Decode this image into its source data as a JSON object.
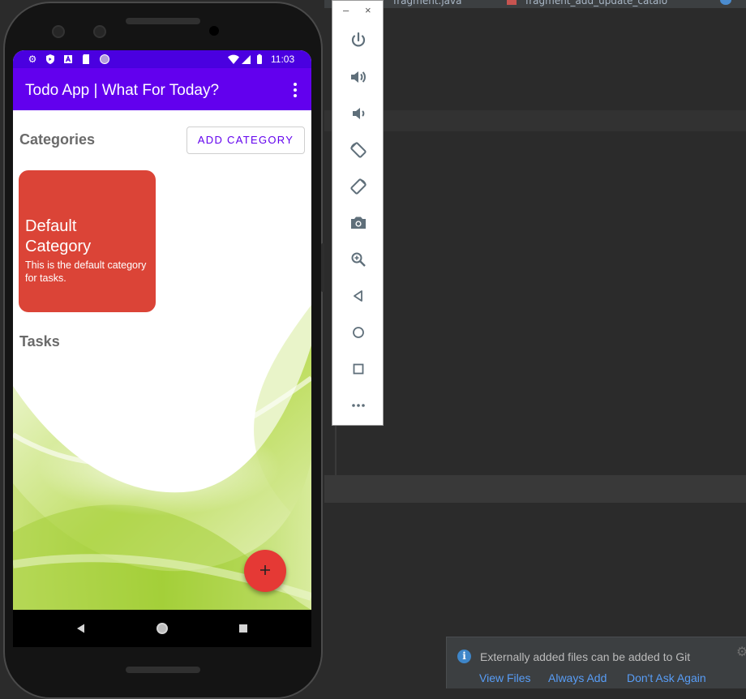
{
  "ide": {
    "tabs": [
      {
        "label": "fragment.java"
      },
      {
        "label": "fragment_add_update_catalo"
      }
    ]
  },
  "notification": {
    "message": "Externally added files can be added to Git",
    "actions": [
      "View Files",
      "Always Add",
      "Don't Ask Again"
    ]
  },
  "emulator_toolbar": {
    "minimize_label": "–",
    "close_label": "×",
    "buttons": [
      "power-icon",
      "volume-up-icon",
      "volume-down-icon",
      "rotate-left-icon",
      "rotate-right-icon",
      "camera-icon",
      "zoom-icon",
      "back-icon",
      "home-icon",
      "overview-icon",
      "more-icon"
    ]
  },
  "phone": {
    "status_bar": {
      "time": "11:03",
      "left_icons": [
        "settings-icon",
        "shield-icon",
        "a-icon",
        "sd-card-icon",
        "circle-icon"
      ],
      "right_icons": [
        "wifi-icon",
        "signal-icon",
        "battery-icon"
      ]
    },
    "app_bar": {
      "title": "Todo App | What For Today?"
    },
    "categories": {
      "heading": "Categories",
      "add_button": "ADD CATEGORY",
      "items": [
        {
          "title": "Default Category",
          "description": "This is the default category for tasks.",
          "color": "#db4437"
        }
      ]
    },
    "tasks": {
      "heading": "Tasks"
    },
    "fab_label": "+"
  },
  "colors": {
    "primary": "#6200ee",
    "status_bar": "#4a00e0",
    "fab": "#e53935",
    "card": "#db4437"
  }
}
